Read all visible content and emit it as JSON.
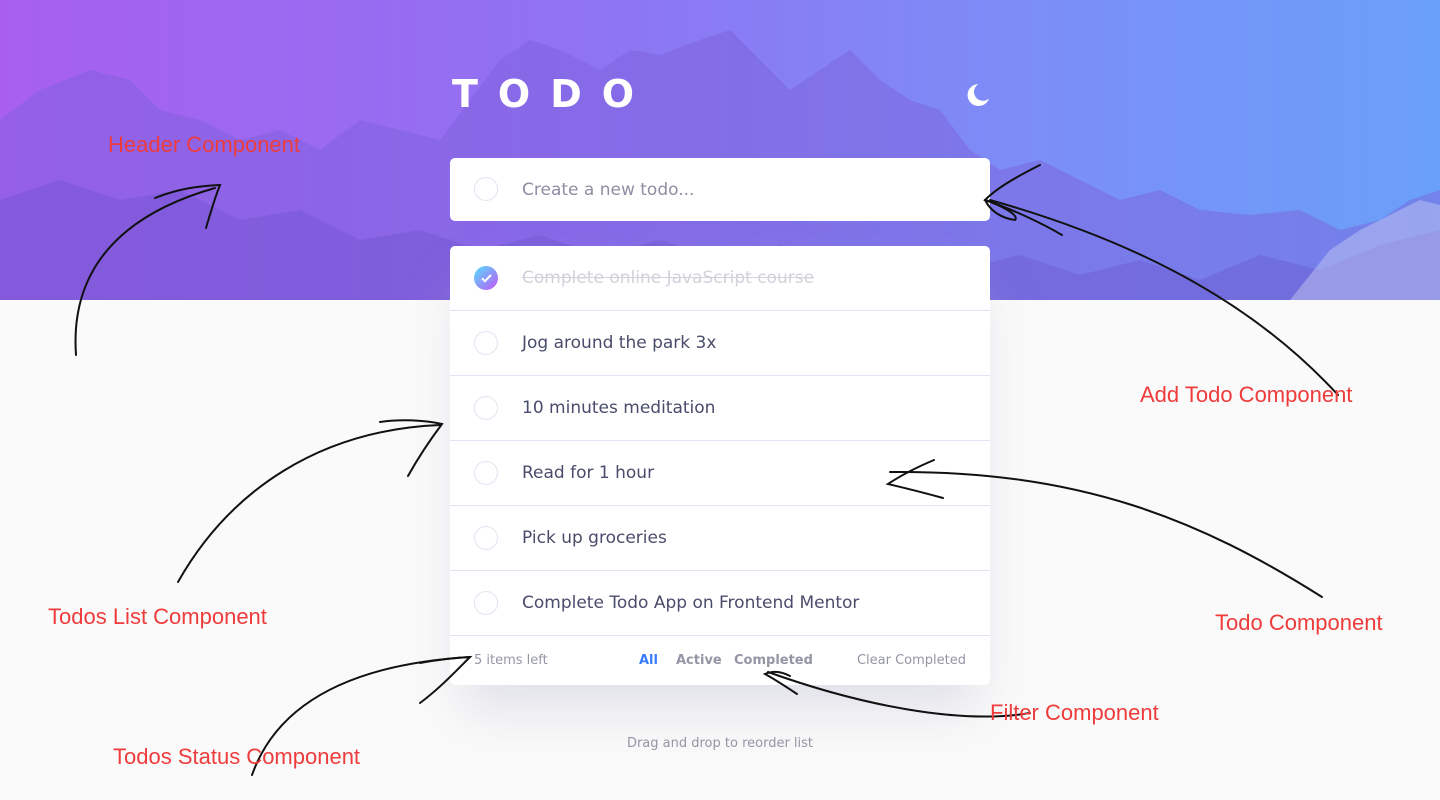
{
  "header": {
    "title": "TODO",
    "theme_icon": "moon-icon"
  },
  "new_todo": {
    "placeholder": "Create a new todo..."
  },
  "todos": [
    {
      "text": "Complete online JavaScript course",
      "completed": true
    },
    {
      "text": "Jog around the park 3x",
      "completed": false
    },
    {
      "text": "10 minutes meditation",
      "completed": false
    },
    {
      "text": "Read for 1 hour",
      "completed": false
    },
    {
      "text": "Pick up groceries",
      "completed": false
    },
    {
      "text": "Complete Todo App on Frontend Mentor",
      "completed": false
    }
  ],
  "footer": {
    "items_left": "5 items left",
    "filters": {
      "all": "All",
      "active": "Active",
      "completed": "Completed"
    },
    "active_filter": "All",
    "clear_completed": "Clear Completed"
  },
  "drag_hint": "Drag and drop to reorder list",
  "annotations": {
    "header": "Header Component",
    "add_todo": "Add Todo Component",
    "todos_list": "Todos List Component",
    "todo": "Todo Component",
    "filter": "Filter Component",
    "todos_status": "Todos Status Component"
  },
  "colors": {
    "accent": "#3a7cfd",
    "check_gradient_start": "#55ddff",
    "check_gradient_end": "#c058f3",
    "annotation": "#ee3b3b"
  }
}
